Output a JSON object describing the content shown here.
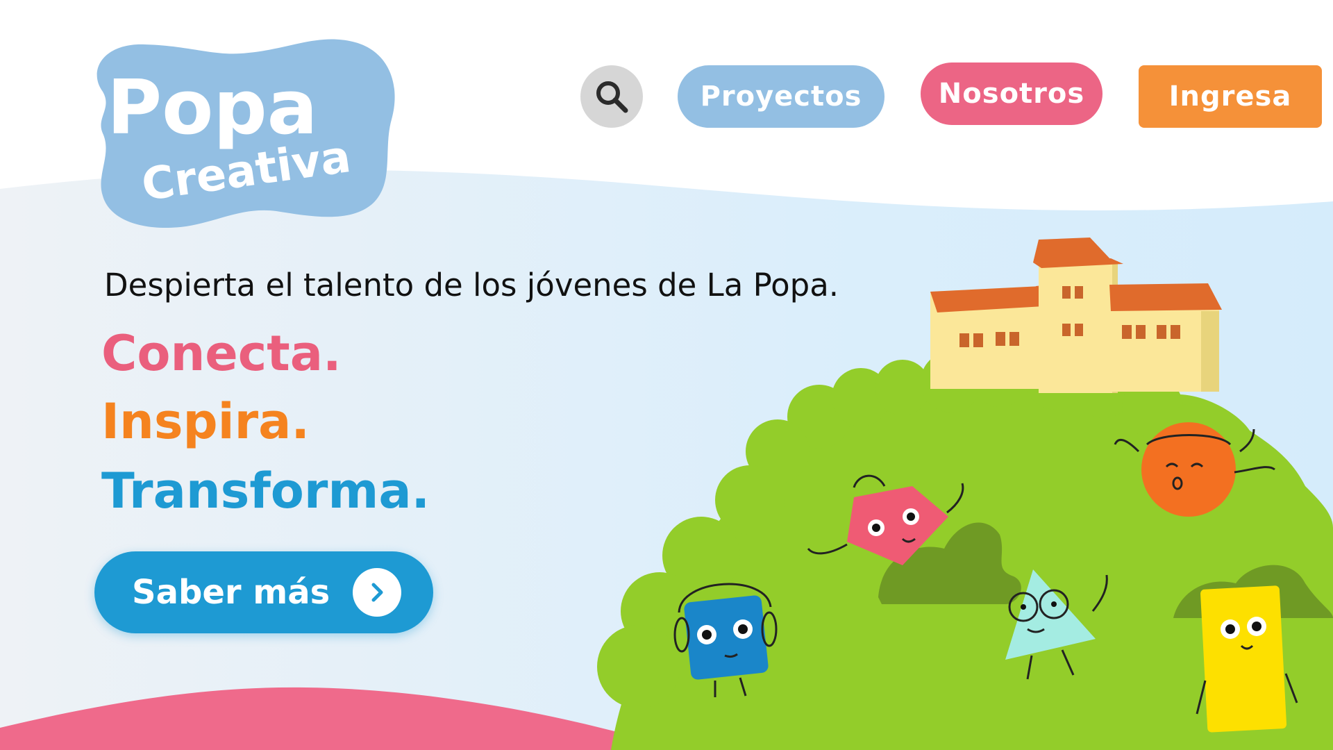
{
  "brand": {
    "logo_line1": "Popa",
    "logo_line2": "Creativa",
    "logo_color": "#93bfe3"
  },
  "nav": {
    "search_icon": "search-icon",
    "items": [
      {
        "label": "Proyectos",
        "color": "#93bfe3"
      },
      {
        "label": "Nosotros",
        "color": "#ec6585"
      },
      {
        "label": "Ingresa",
        "color": "#f59139"
      }
    ]
  },
  "hero": {
    "tagline": "Despierta el talento de los jóvenes de La Popa.",
    "words": [
      {
        "text": "Conecta.",
        "color": "#ea5f7d"
      },
      {
        "text": "Inspira.",
        "color": "#f5831f"
      },
      {
        "text": "Transforma.",
        "color": "#1e9ad3"
      }
    ],
    "cta_label": "Saber más",
    "cta_icon": "chevron-right-icon"
  },
  "colors": {
    "sky": "#dbeefb",
    "hill": "#93cd2a",
    "bush": "#7ab82c",
    "wave_pink": "#ef6a8b",
    "building": "#fbe799",
    "roof": "#e06b2c"
  }
}
